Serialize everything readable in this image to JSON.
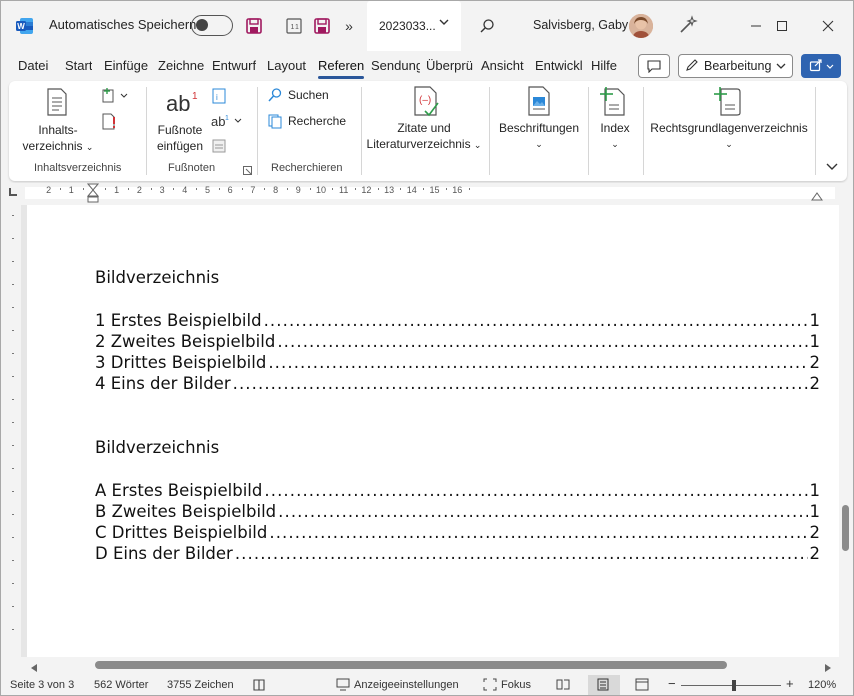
{
  "titlebar": {
    "autosave_label": "Automatisches Speichern",
    "doc_name": "2023033...",
    "user_name": "Salvisberg, Gaby"
  },
  "tabs": [
    "Datei",
    "Start",
    "Einfüge",
    "Zeichne",
    "Entwurf",
    "Layout",
    "Referen",
    "Sendung",
    "Überprü",
    "Ansicht",
    "Entwickl",
    "Hilfe"
  ],
  "active_tab": "Referen",
  "edit_mode_label": "Bearbeitung",
  "ribbon": {
    "toc_button_line1": "Inhalts-",
    "toc_button_line2": "verzeichnis",
    "toc_group": "Inhaltsverzeichnis",
    "footnote_line1": "Fußnote",
    "footnote_line2": "einfügen",
    "footnote_group": "Fußnoten",
    "search_label": "Suchen",
    "research_label": "Recherche",
    "research_group": "Recherchieren",
    "citations_line1": "Zitate und",
    "citations_line2": "Literaturverzeichnis",
    "captions_label": "Beschriftungen",
    "index_label": "Index",
    "authorities_label": "Rechtsgrundlagenverzeichnis"
  },
  "document": {
    "sections": [
      {
        "heading": "Bildverzeichnis",
        "entries": [
          {
            "label": "1 Erstes Beispielbild",
            "page": "1"
          },
          {
            "label": "2 Zweites Beispielbild",
            "page": "1"
          },
          {
            "label": "3 Drittes Beispielbild",
            "page": "2"
          },
          {
            "label": "4 Eins der Bilder",
            "page": "2"
          }
        ]
      },
      {
        "heading": "Bildverzeichnis",
        "entries": [
          {
            "label": "A Erstes Beispielbild",
            "page": "1"
          },
          {
            "label": "B Zweites Beispielbild",
            "page": "1"
          },
          {
            "label": "C Drittes Beispielbild",
            "page": "2"
          },
          {
            "label": "D Eins der Bilder",
            "page": "2"
          }
        ]
      }
    ]
  },
  "statusbar": {
    "page": "Seite 3 von 3",
    "words": "562 Wörter",
    "chars": "3755 Zeichen",
    "display_settings": "Anzeigeeinstellungen",
    "focus": "Fokus",
    "zoom": "120%"
  },
  "colors": {
    "accent": "#2b579a",
    "share": "#2f64b1",
    "word_blue": "#185abd"
  }
}
